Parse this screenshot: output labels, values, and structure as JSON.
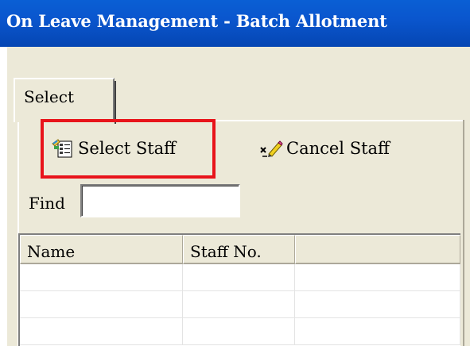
{
  "window": {
    "title": "On Leave Management - Batch Allotment"
  },
  "tabs": [
    {
      "label": "Select",
      "active": true
    }
  ],
  "toolbar": {
    "select_staff_label": "Select Staff",
    "select_staff_icon": "staff-list-icon",
    "cancel_staff_label": "Cancel Staff",
    "cancel_staff_icon": "eraser-pencil-icon"
  },
  "find": {
    "label": "Find",
    "value": "",
    "placeholder": ""
  },
  "grid": {
    "columns": [
      "Name",
      "Staff No.",
      ""
    ],
    "rows": [
      [
        "",
        "",
        ""
      ],
      [
        "",
        "",
        ""
      ],
      [
        "",
        "",
        ""
      ]
    ]
  },
  "colors": {
    "title_bar": "#0a56ce",
    "dialog_bg": "#ece9d8",
    "highlight": "#e8141b"
  }
}
